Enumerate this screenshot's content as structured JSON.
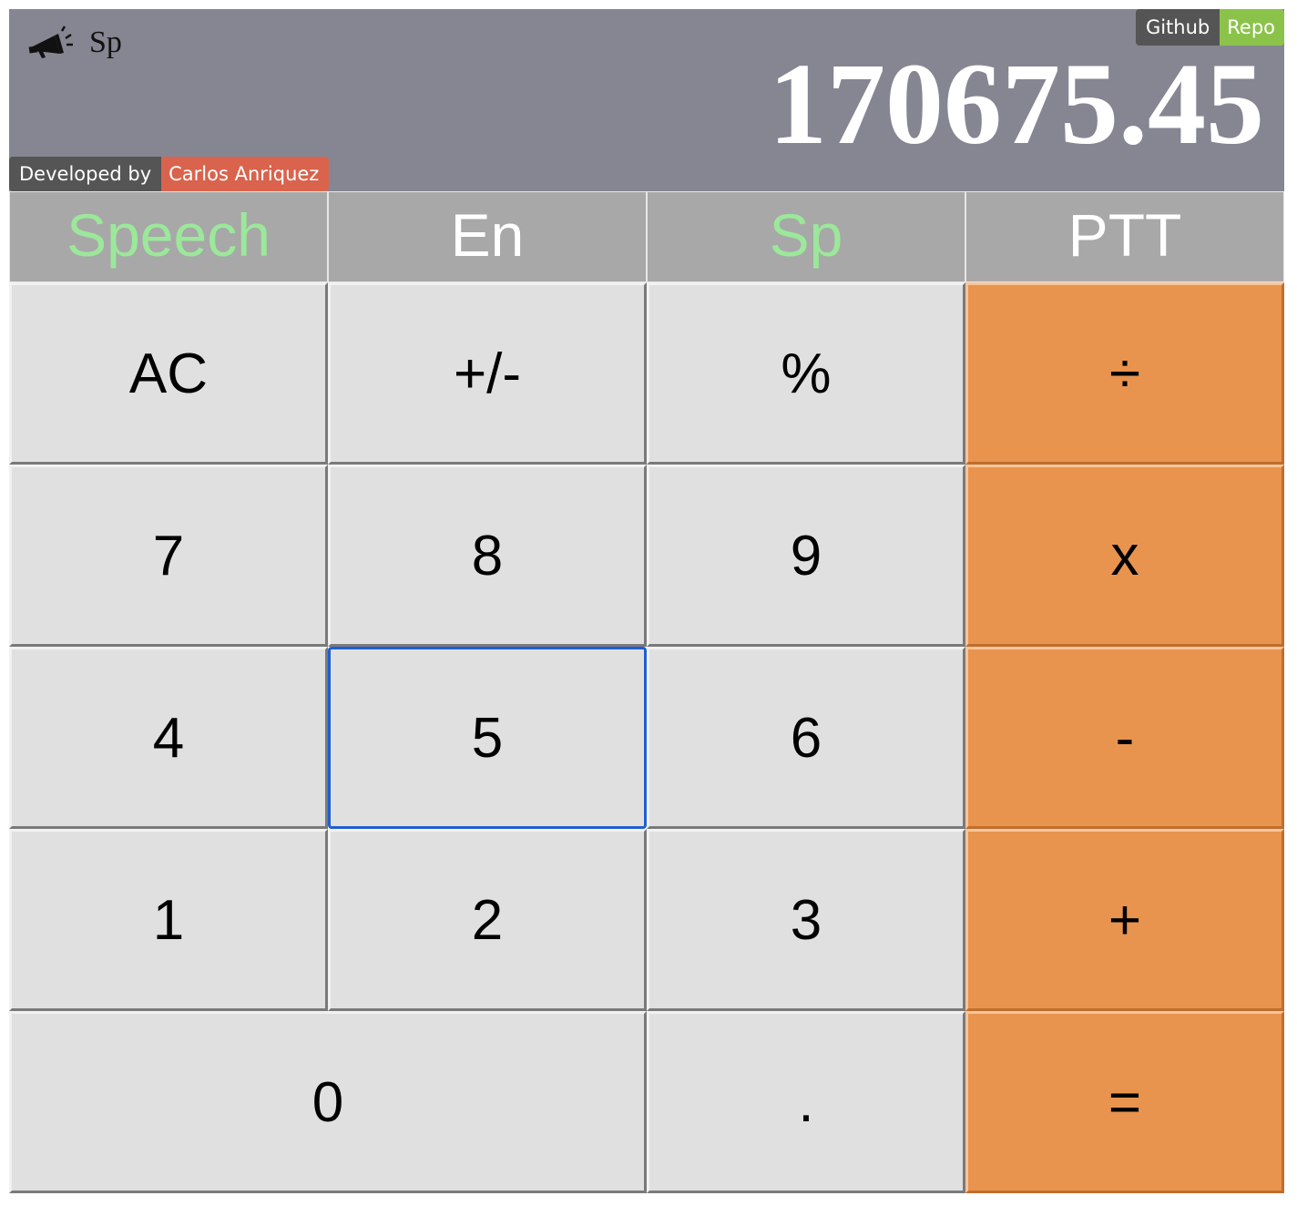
{
  "display": {
    "speaker_icon": "megaphone-icon",
    "language_indicator": "Sp",
    "result": "170675.45",
    "github_badge": {
      "left": "Github",
      "right": "Repo",
      "right_color": "#8bc34a"
    },
    "developer_badge": {
      "left": "Developed by",
      "right": "Carlos Anriquez",
      "right_color": "#d9634c"
    },
    "background_color": "#868692"
  },
  "tabs": [
    {
      "label": "Speech",
      "color": "#9be89b"
    },
    {
      "label": "En",
      "color": "#ffffff"
    },
    {
      "label": "Sp",
      "color": "#9be89b"
    },
    {
      "label": "PTT",
      "color": "#ffffff"
    }
  ],
  "keys": {
    "ac": "AC",
    "sign": "+/-",
    "percent": "%",
    "divide": "÷",
    "seven": "7",
    "eight": "8",
    "nine": "9",
    "multiply": "x",
    "four": "4",
    "five": "5",
    "six": "6",
    "minus": "-",
    "one": "1",
    "two": "2",
    "three": "3",
    "plus": "+",
    "zero": "0",
    "decimal": ".",
    "equals": "="
  },
  "colors": {
    "operator": "#e8944e",
    "key": "#e0e0e0",
    "focus": "#1f5fd0"
  }
}
